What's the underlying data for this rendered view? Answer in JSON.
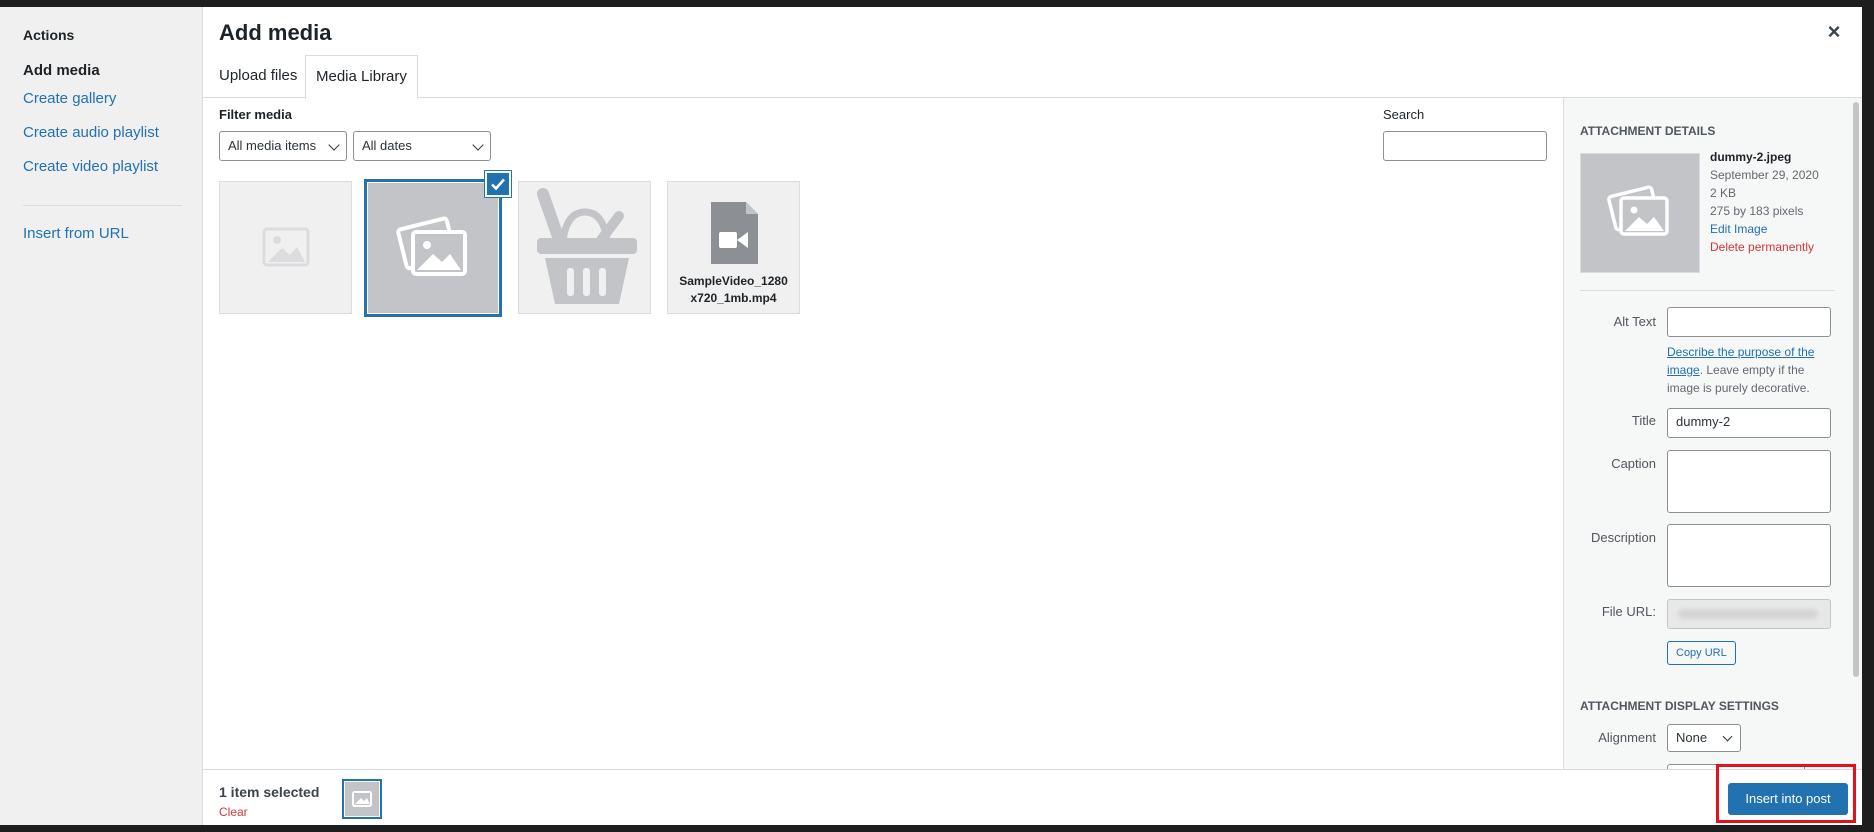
{
  "menu": {
    "heading": "Actions",
    "items": [
      {
        "label": "Add media",
        "active": true
      },
      {
        "label": "Create gallery"
      },
      {
        "label": "Create audio playlist"
      },
      {
        "label": "Create video playlist"
      },
      {
        "label": "Insert from URL"
      }
    ]
  },
  "header": {
    "title": "Add media",
    "close_icon": "close-icon"
  },
  "tabs": [
    {
      "label": "Upload files"
    },
    {
      "label": "Media Library",
      "active": true
    }
  ],
  "toolbar": {
    "filter_label": "Filter media",
    "type_filter": "All media items",
    "date_filter": "All dates",
    "search_label": "Search",
    "search_value": ""
  },
  "library": {
    "items": [
      {
        "type": "image-placeholder",
        "selected": false
      },
      {
        "type": "image-placeholder",
        "selected": true
      },
      {
        "type": "basket-image",
        "selected": false
      },
      {
        "type": "video",
        "filename_line1": "SampleVideo_1280",
        "filename_line2": "x720_1mb.mp4",
        "selected": false
      }
    ]
  },
  "details": {
    "heading": "Attachment Details",
    "filename": "dummy-2.jpeg",
    "date": "September 29, 2020",
    "size": "2 KB",
    "dimensions": "275 by 183 pixels",
    "edit_link": "Edit Image",
    "delete_link": "Delete permanently",
    "alt_label": "Alt Text",
    "alt_value": "",
    "alt_help_link": "Describe the purpose of the image",
    "alt_help_text": ". Leave empty if the image is purely decorative.",
    "title_label": "Title",
    "title_value": "dummy-2",
    "caption_label": "Caption",
    "description_label": "Description",
    "file_url_label": "File URL:",
    "copy_url": "Copy URL"
  },
  "display_settings": {
    "heading": "Attachment Display Settings",
    "alignment_label": "Alignment",
    "alignment_value": "None"
  },
  "footer": {
    "selected_count": "1 item selected",
    "clear": "Clear",
    "insert_button": "Insert into post"
  },
  "colors": {
    "accent": "#2271b1",
    "danger": "#d63638",
    "highlight": "#e3111b"
  }
}
